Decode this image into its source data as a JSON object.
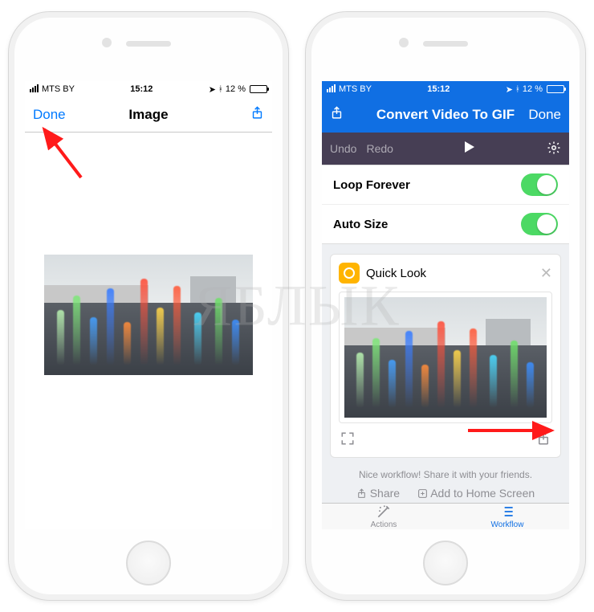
{
  "status": {
    "carrier": "MTS BY",
    "time": "15:12",
    "battery_pct": "12 %",
    "battery_fill": "13%",
    "battery_color_low": "#ff3b30"
  },
  "left": {
    "done": "Done",
    "title": "Image"
  },
  "right": {
    "title": "Convert Video To GIF",
    "done": "Done",
    "undo": "Undo",
    "redo": "Redo",
    "loop_forever": "Loop Forever",
    "auto_size": "Auto Size",
    "quick_look": "Quick Look",
    "share_prompt": "Nice workflow! Share it with your friends.",
    "share": "Share",
    "add_home": "Add to Home Screen",
    "tab_actions": "Actions",
    "tab_workflow": "Workflow"
  },
  "watermark": "ЯБЛЫК",
  "fountain_jets": [
    {
      "left": "6%",
      "h": "46%",
      "c": "#b7f0b0"
    },
    {
      "left": "14%",
      "h": "58%",
      "c": "#7fe67a"
    },
    {
      "left": "22%",
      "h": "40%",
      "c": "#45a0ff"
    },
    {
      "left": "30%",
      "h": "64%",
      "c": "#3a7dff"
    },
    {
      "left": "38%",
      "h": "36%",
      "c": "#ff8c3a"
    },
    {
      "left": "46%",
      "h": "72%",
      "c": "#ff4f3a"
    },
    {
      "left": "54%",
      "h": "48%",
      "c": "#ffd54a"
    },
    {
      "left": "62%",
      "h": "66%",
      "c": "#ff5a3a"
    },
    {
      "left": "72%",
      "h": "44%",
      "c": "#4ad9ff"
    },
    {
      "left": "82%",
      "h": "56%",
      "c": "#6fe06a"
    },
    {
      "left": "90%",
      "h": "38%",
      "c": "#3c8fff"
    }
  ]
}
